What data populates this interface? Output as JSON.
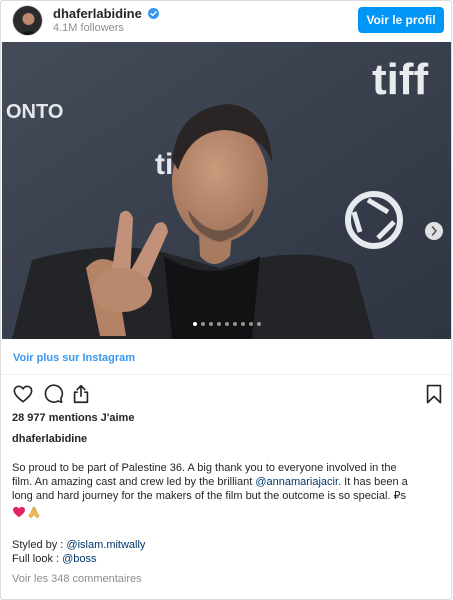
{
  "post": {
    "username": "dhaferlabidine",
    "followers": "4.1M followers",
    "profile_button": "Voir le profil",
    "photo_description": "",
    "carousel": {
      "count": 9,
      "active": 1
    },
    "more_on_instagram": "Voir plus sur Instagram",
    "likes": "28 977 mentions J'aime",
    "caption_owner": "dhaferlabidine",
    "caption": "So proud to be part of Palestine 36. A big thank you to everyone involved in the film. An amazing cast and crew led by the brilliant @annamariajacir. It has been a long and hard journey for the makers of the film but the outcome is so special. 🇵🇸",
    "caption_lines": [
      "So proud to be part of Palestine 36. A big thank you to everyone involved in the",
      "film. An amazing cast and crew led by the brilliant ",
      "@annamariajacir",
      ". It has been a",
      "long and hard journey for the makers of the film but the outcome is so special. ₽s"
    ],
    "styled_by_label": "Styled by : ",
    "styled_by_handle": "@islam.mitwally",
    "full_look_label": "Full look : ",
    "full_look_handle": "@boss",
    "view_comments": "Voir les 348 commentaires",
    "photo_signage": [
      "tiff",
      "ONTO",
      "ti"
    ],
    "icons": {
      "verified": "verified-badge-icon",
      "like": "heart-outline-icon",
      "comment": "comment-bubble-icon",
      "share": "share-upload-icon",
      "save": "bookmark-icon",
      "next": "chevron-right-icon",
      "emoji_1": "red-heart-emoji",
      "emoji_2": "folded-hands-emoji"
    },
    "colors": {
      "accent": "#0095f6",
      "link": "#3897f0",
      "mention": "#00376b",
      "muted": "#8e8e8e",
      "border": "#dbdbdb"
    }
  }
}
